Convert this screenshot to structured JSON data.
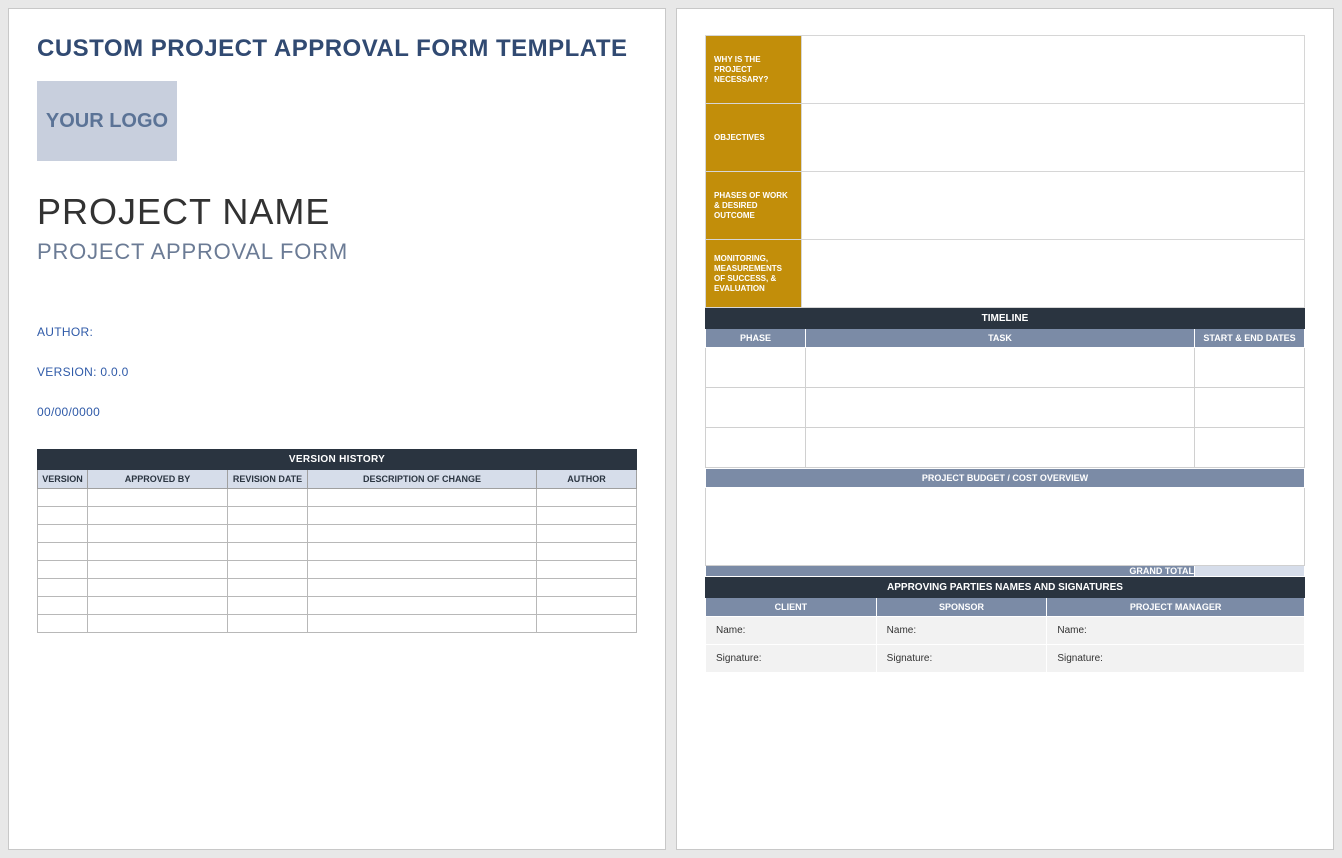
{
  "page1": {
    "doc_title": "CUSTOM PROJECT APPROVAL FORM TEMPLATE",
    "logo_text": "YOUR LOGO",
    "project_name": "PROJECT NAME",
    "subtitle": "PROJECT APPROVAL FORM",
    "author_line": "AUTHOR:",
    "version_line": "VERSION: 0.0.0",
    "date_line": "00/00/0000",
    "version_history": {
      "header": "VERSION HISTORY",
      "columns": [
        "VERSION",
        "APPROVED BY",
        "REVISION DATE",
        "DESCRIPTION OF CHANGE",
        "AUTHOR"
      ],
      "row_count": 8
    }
  },
  "page2": {
    "info_rows": [
      "WHY IS THE PROJECT NECESSARY?",
      "OBJECTIVES",
      "PHASES OF WORK\n& DESIRED OUTCOME",
      "MONITORING, MEASUREMENTS OF SUCCESS,\n & EVALUATION"
    ],
    "timeline": {
      "header": "TIMELINE",
      "columns": [
        "PHASE",
        "TASK",
        "START & END DATES"
      ],
      "row_count": 3
    },
    "budget": {
      "header": "PROJECT BUDGET / COST OVERVIEW",
      "grand_total_label": "GRAND TOTAL"
    },
    "signatures": {
      "header": "APPROVING PARTIES NAMES AND SIGNATURES",
      "columns": [
        "CLIENT",
        "SPONSOR",
        "PROJECT MANAGER"
      ],
      "name_label": "Name:",
      "sig_label": "Signature:"
    }
  }
}
